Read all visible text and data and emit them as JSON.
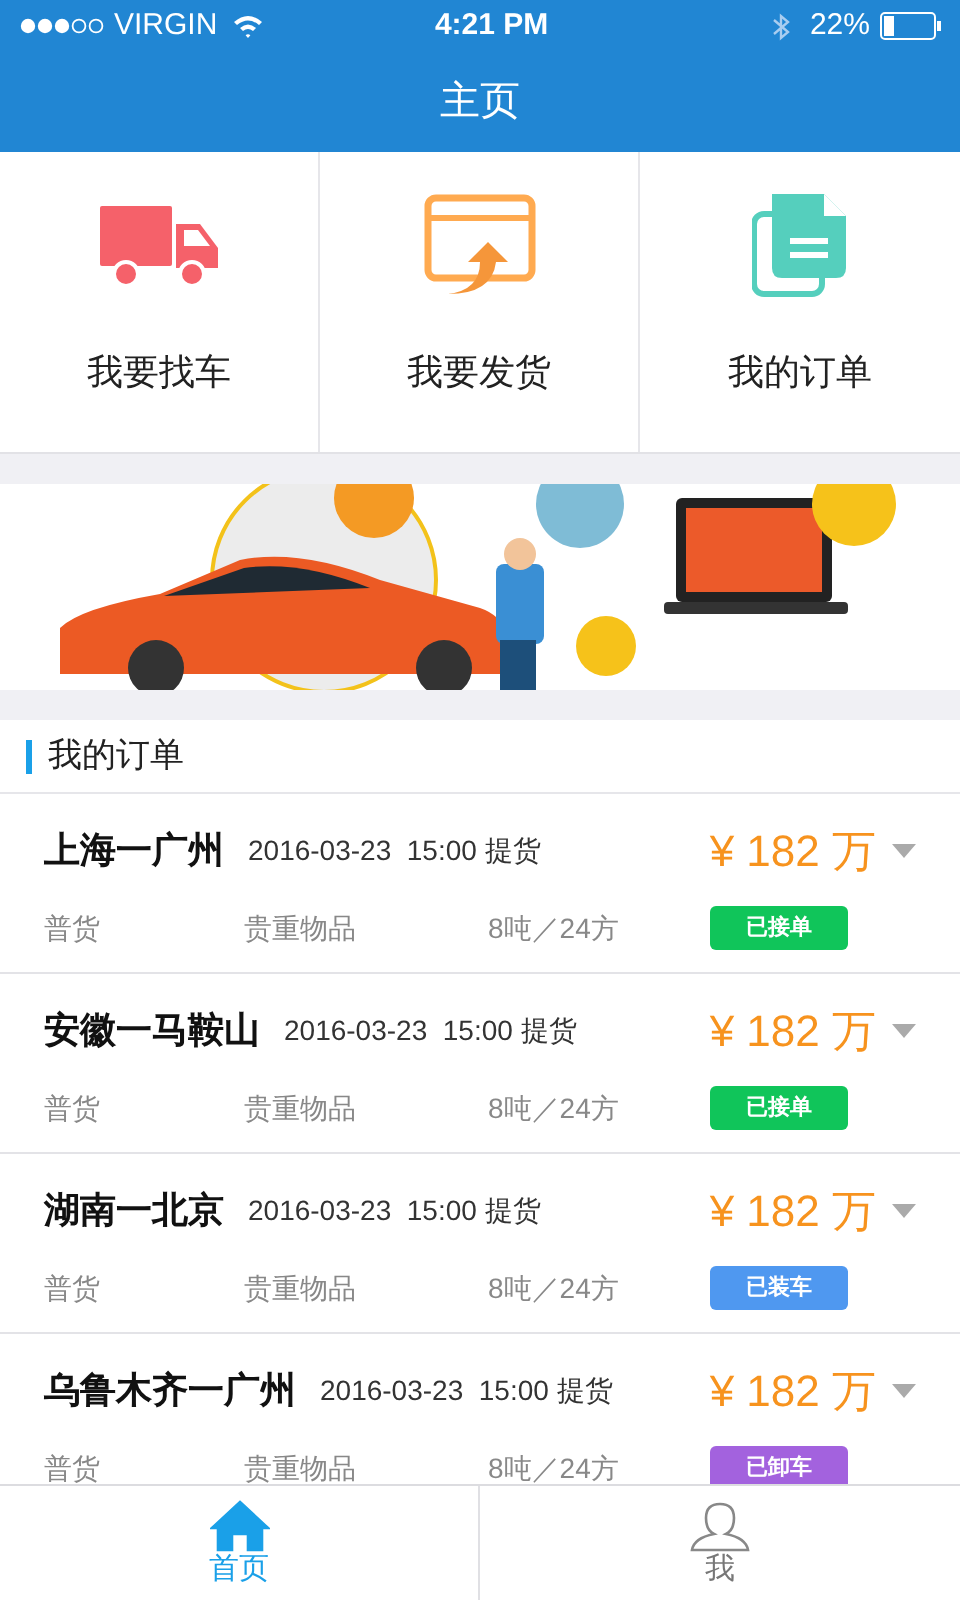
{
  "status_bar": {
    "carrier": "VIRGIN",
    "time": "4:21 PM",
    "battery": "22%"
  },
  "header": {
    "title": "主页"
  },
  "shortcuts": [
    {
      "label": "我要找车",
      "kind": "truck"
    },
    {
      "label": "我要发货",
      "kind": "upload"
    },
    {
      "label": "我的订单",
      "kind": "document"
    }
  ],
  "orders_section": {
    "title": "我的订单"
  },
  "orders": [
    {
      "route": "上海一广州",
      "pickup": "2016-03-23  15:00 提货",
      "price": "¥ 182 万",
      "cargo_type": "普货",
      "cargo_name": "贵重物品",
      "size": "8吨／24方",
      "status": "已接单",
      "color": "#10c55a"
    },
    {
      "route": "安徽一马鞍山",
      "pickup": "2016-03-23  15:00 提货",
      "price": "¥ 182 万",
      "cargo_type": "普货",
      "cargo_name": "贵重物品",
      "size": "8吨／24方",
      "status": "已接单",
      "color": "#10c55a"
    },
    {
      "route": "湖南一北京",
      "pickup": "2016-03-23  15:00 提货",
      "price": "¥ 182 万",
      "cargo_type": "普货",
      "cargo_name": "贵重物品",
      "size": "8吨／24方",
      "status": "已装车",
      "color": "#4f98f0"
    },
    {
      "route": "乌鲁木齐一广州",
      "pickup": "2016-03-23  15:00 提货",
      "price": "¥ 182 万",
      "cargo_type": "普货",
      "cargo_name": "贵重物品",
      "size": "8吨／24方",
      "status": "已卸车",
      "color": "#a362de"
    }
  ],
  "tab_bar": [
    {
      "label": "首页",
      "kind": "home",
      "selected": true
    },
    {
      "label": "我",
      "kind": "person",
      "selected": false
    }
  ]
}
